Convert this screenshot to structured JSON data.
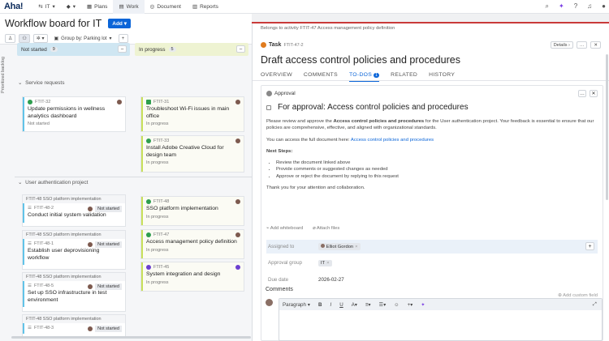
{
  "topbar": {
    "logo": "Aha!",
    "workspace": "IT",
    "nav": [
      {
        "label": "Plans",
        "icon": "calendar-icon"
      },
      {
        "label": "Work",
        "icon": "grid-icon"
      },
      {
        "label": "Document",
        "icon": "document-icon"
      },
      {
        "label": "Reports",
        "icon": "reports-icon"
      }
    ],
    "icons": [
      "search-icon",
      "ai-sparkle-icon",
      "help-icon",
      "notifications-icon",
      "user-icon"
    ]
  },
  "board": {
    "title": "Workflow board for IT",
    "add_label": "Add",
    "group_by_label": "Group by: Parking lot",
    "backlog_label": "Prioritized backlog",
    "columns": [
      {
        "label": "Not started",
        "count": "9",
        "color": "#cfe6f2"
      },
      {
        "label": "In progress",
        "count": "5",
        "color": "#eef3d2"
      }
    ],
    "groups": [
      {
        "label": "Service requests"
      },
      {
        "label": "User authentication project"
      }
    ],
    "service_cards_not_started": [
      {
        "id": "FTIT-32",
        "title": "Update permissions in wellness analytics dashboard",
        "status": "Not started"
      }
    ],
    "service_cards_in_progress": [
      {
        "id": "FTIT-31",
        "title": "Troubleshoot Wi-Fi issues in main office",
        "status": "In progress"
      },
      {
        "id": "FTIT-33",
        "title": "Install Adobe Creative Cloud for design team",
        "status": "In progress"
      }
    ],
    "auth_cards_not_started": [
      {
        "feature": "FTIT-48 SSO platform implementation",
        "id": "FTIT-48-2",
        "title": "Conduct initial system validation",
        "status": "Not started"
      },
      {
        "feature": "FTIT-48 SSO platform implementation",
        "id": "FTIT-48-1",
        "title": "Establish user deprovisioning workflow",
        "status": "Not started"
      },
      {
        "feature": "FTIT-48 SSO platform implementation",
        "id": "FTIT-48-5",
        "title": "Set up SSO infrastructure in test environment",
        "status": "Not started"
      },
      {
        "feature": "FTIT-48 SSO platform implementation",
        "id": "FTIT-48-3",
        "title": "",
        "status": "Not started"
      }
    ],
    "auth_cards_in_progress": [
      {
        "id": "FTIT-48",
        "title": "SSO platform implementation",
        "status": "In progress"
      },
      {
        "id": "FTIT-47",
        "title": "Access management policy definition",
        "status": "In progress"
      },
      {
        "id": "FTIT-45",
        "title": "System integration and design",
        "status": "In progress"
      }
    ]
  },
  "panel": {
    "belongs_to": "Belongs to activity FTIT-47 Access management policy definition",
    "type_label": "Task",
    "task_id": "FTIT-47-2",
    "details_label": "Details",
    "title": "Draft access control policies and procedures",
    "tabs": [
      {
        "label": "OVERVIEW"
      },
      {
        "label": "COMMENTS"
      },
      {
        "label": "TO-DOS",
        "badge": "1"
      },
      {
        "label": "RELATED"
      },
      {
        "label": "HISTORY"
      }
    ],
    "approval": {
      "header": "Approval",
      "title": "For approval: Access control policies and procedures",
      "p1_before": "Please review and approve the ",
      "p1_bold": "Access control policies and procedures",
      "p1_after": " for the User authentication project. Your feedback is essential to ensure that our policies are comprehensive, effective, and aligned with organizational standards.",
      "p2_before": "You can access the full document here: ",
      "p2_link": "Access control policies and procedures",
      "next_steps_label": "Next Steps:",
      "steps": [
        "Review the document linked above",
        "Provide comments or suggested changes as needed",
        "Approve or reject the document by replying to this request"
      ],
      "thanks": "Thank you for your attention and collaboration.",
      "add_whiteboard": "Add whiteboard",
      "attach_files": "Attach files",
      "fields": {
        "assigned_to_label": "Assigned to",
        "assigned_to_value": "Elliot Gordon",
        "approval_group_label": "Approval group",
        "approval_group_value": "IT",
        "due_date_label": "Due date",
        "due_date_value": "2026-02-27"
      },
      "add_custom_field": "Add custom field"
    },
    "comments_label": "Comments",
    "editor": {
      "paragraph_label": "Paragraph"
    }
  }
}
